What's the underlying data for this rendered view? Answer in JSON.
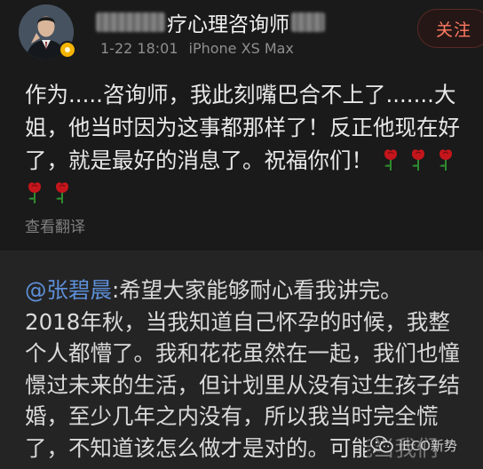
{
  "post": {
    "author": {
      "name_visible": "疗心理咨询师",
      "verified": true,
      "avatar_icon": "avatar-photo-icon"
    },
    "timestamp": "1-22 18:01",
    "device": "iPhone XS Max",
    "follow_label": "关注",
    "body_lines": [
      "作为.....咨询师，我此刻嘴巴合不上了.......大",
      "姐，他当时因为这事都那样了！反正他现在好",
      "了，就是最好的消息了。祝福你们！"
    ],
    "translate_label": "查看翻译",
    "emoji": "rose-icon",
    "rose_count_line3": 3,
    "rose_count_line4": 2
  },
  "repost": {
    "mention": "@张碧晨",
    "first_line_rest": ":希望大家能够耐心看我讲完。",
    "lines": [
      "2018年秋，当我知道自己怀孕的时候，我整",
      "个人都懵了。我和花花虽然在一起，我们也憧",
      "憬过未来的生活，但计划里从没有过生孩子结",
      "婚，至少几年之内没有，所以我当时完全慌",
      "了，不知道该怎么做才是对的。可能当我们"
    ]
  },
  "watermark": {
    "text": "iECO新势",
    "icon": "wechat-icon"
  },
  "colors": {
    "background": "#1a1a1a",
    "repost_background": "#242424",
    "follow_accent": "#ff7a62",
    "mention": "#5d8fd8",
    "rose": "#c4161c"
  }
}
